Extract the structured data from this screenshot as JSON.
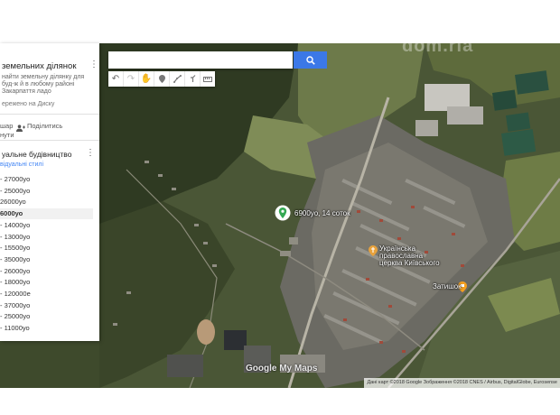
{
  "panel": {
    "title": "земельних ділянок",
    "description": "найти земельну ділянку для буд-ж й в любому районі Закарпаття ладо",
    "saved_note": "ережено на Диску",
    "share_label": "шар",
    "add_person_label": "Поділитись",
    "open_label": "нути",
    "layer_title": "уальне будівництво",
    "styles_link": "відуальні стилі",
    "items": [
      {
        "label": "- 27000уо",
        "selected": false
      },
      {
        "label": "- 25000уо",
        "selected": false
      },
      {
        "label": "26000уо",
        "selected": false
      },
      {
        "label": "6000уо",
        "selected": true
      },
      {
        "label": "- 14000уо",
        "selected": false
      },
      {
        "label": "- 13000уо",
        "selected": false
      },
      {
        "label": "- 15500уо",
        "selected": false
      },
      {
        "label": "- 35000уо",
        "selected": false
      },
      {
        "label": "- 26000уо",
        "selected": false
      },
      {
        "label": "- 18000уо",
        "selected": false
      },
      {
        "label": "- 120000е",
        "selected": false
      },
      {
        "label": "- 37000уо",
        "selected": false
      },
      {
        "label": "- 25000уо",
        "selected": false
      },
      {
        "label": "- 11000уо",
        "selected": false
      }
    ]
  },
  "search": {
    "placeholder": ""
  },
  "map": {
    "marker_label": "6900уо, 14 соток",
    "church_label": "Українська православна церква Київського",
    "cafe_label": "Затишок",
    "logo_text": "Google My Maps",
    "attribution": "Дані карт ©2018 Google Зображення ©2018 CNES / Airbus, DigitalGlobe, Eurosense"
  },
  "watermark": "dom.ria",
  "colors": {
    "accent": "#3b78e7",
    "marker": "#34a853",
    "cafe_pin": "#f4a020",
    "church_pin": "#e8a23c",
    "panel_selected": "#f1f1f1",
    "link": "#4285f4"
  },
  "icons": [
    "search-icon",
    "undo-icon",
    "redo-icon",
    "hand-icon",
    "marker-icon",
    "line-icon",
    "directions-icon",
    "ruler-icon",
    "more-vert-icon",
    "person-add-icon",
    "map-pin-icon",
    "cafe-pin-icon",
    "church-pin-icon"
  ]
}
